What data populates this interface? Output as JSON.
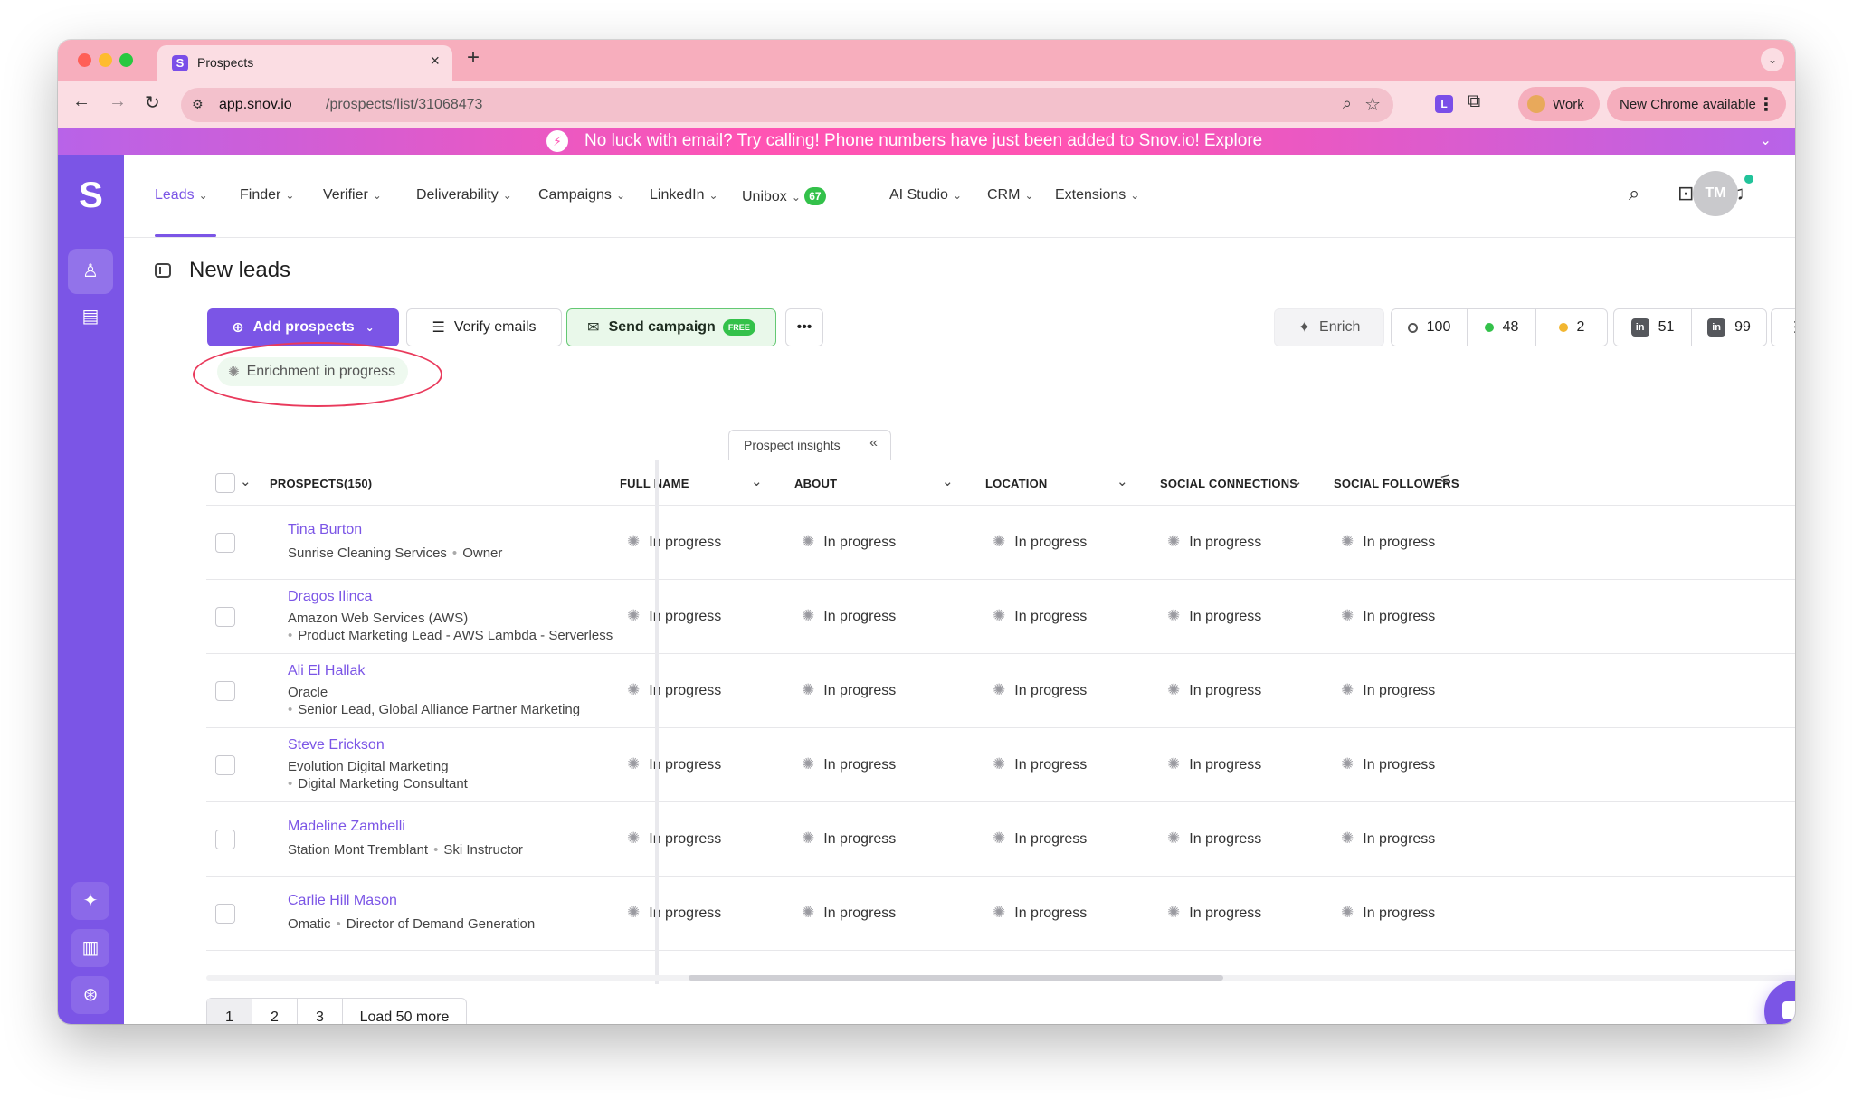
{
  "browser": {
    "tab_title": "Prospects",
    "url_host": "app.snov.io",
    "url_path": "/prospects/list/31068473",
    "profile_label": "Work",
    "update_label": "New Chrome available"
  },
  "banner": {
    "text": "No luck with email? Try calling! Phone numbers have just been added to Snov.io!",
    "link": "Explore"
  },
  "nav": {
    "items": [
      "Leads",
      "Finder",
      "Verifier",
      "Deliverability",
      "Campaigns",
      "LinkedIn",
      "Unibox",
      "AI Studio",
      "CRM",
      "Extensions"
    ],
    "unibox_badge": "67",
    "avatar_initials": "TM"
  },
  "page": {
    "title": "New leads",
    "add_prospects": "Add prospects",
    "verify_emails": "Verify emails",
    "send_campaign": "Send campaign",
    "free_badge": "FREE",
    "enrich": "Enrich",
    "stats": {
      "total": "100",
      "green": "48",
      "yellow": "2",
      "li_a": "51",
      "li_b": "99"
    },
    "enrichment_status": "Enrichment in progress",
    "insights_tab": "Prospect insights"
  },
  "table": {
    "prospects_header": "PROSPECTS(150)",
    "columns": [
      "FULL NAME",
      "ABOUT",
      "LOCATION",
      "SOCIAL CONNECTIONS",
      "SOCIAL FOLLOWERS"
    ],
    "status": "In progress",
    "rows": [
      {
        "name": "Tina Burton",
        "company": "Sunrise Cleaning Services",
        "title": "Owner"
      },
      {
        "name": "Dragos Ilinca",
        "company": "Amazon Web Services (AWS)",
        "title": "Product Marketing Lead - AWS Lambda - Serverless"
      },
      {
        "name": "Ali El Hallak",
        "company": "Oracle",
        "title": "Senior Lead, Global Alliance Partner Marketing"
      },
      {
        "name": "Steve Erickson",
        "company": "Evolution Digital Marketing",
        "title": "Digital Marketing Consultant"
      },
      {
        "name": "Madeline Zambelli",
        "company": "Station Mont Tremblant",
        "title": "Ski Instructor"
      },
      {
        "name": "Carlie Hill Mason",
        "company": "Omatic",
        "title": "Director of Demand Generation"
      }
    ]
  },
  "pagination": {
    "pages": [
      "1",
      "2",
      "3"
    ],
    "load_more": "Load 50 more"
  }
}
